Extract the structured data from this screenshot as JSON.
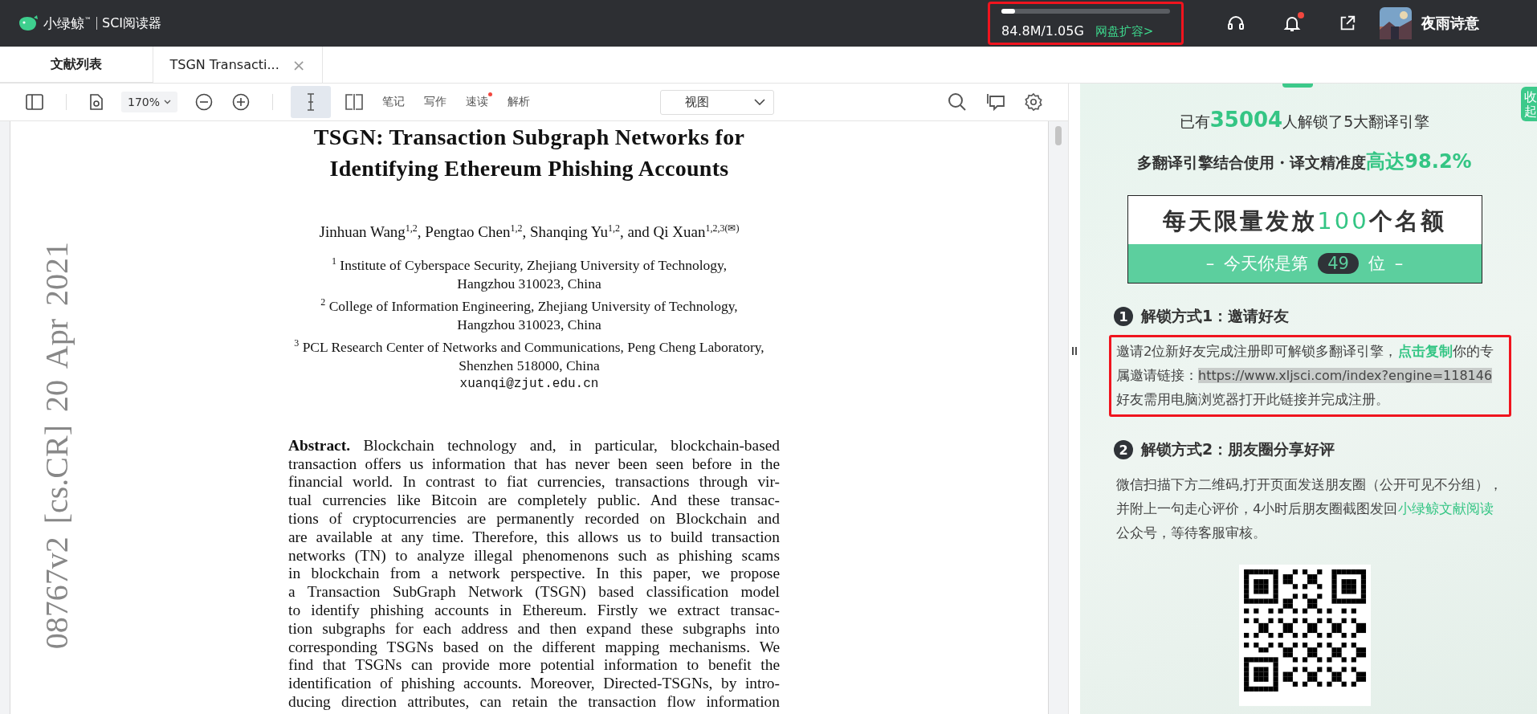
{
  "app_bar": {
    "logo_text": "小绿鲸",
    "trademark": "™",
    "product": "SCI阅读器",
    "storage": {
      "level": 0.08,
      "usage": "84.8M/1.05G",
      "upgrade_link": "网盘扩容>",
      "annotated": true
    },
    "notification_badge": true,
    "user_name": "夜雨诗意"
  },
  "tabs": [
    {
      "label": "文献列表",
      "kind": "home",
      "selected": false
    },
    {
      "label": "TSGN Transacti...",
      "kind": "document",
      "selected": true,
      "close": "×"
    }
  ],
  "toolbar": {
    "zoom": "170%",
    "text_select_active": true,
    "tools": [
      {
        "label": "笔记",
        "badge": false
      },
      {
        "label": "写作",
        "badge": false
      },
      {
        "label": "速读",
        "badge": true
      },
      {
        "label": "解析",
        "badge": false
      }
    ],
    "view": "视图"
  },
  "pdf": {
    "side_stamp": "08767v2 [cs.CR] 20 Apr 2021",
    "title_lines": [
      "TSGN: Transaction Subgraph Networks for",
      "Identifying Ethereum Phishing Accounts"
    ],
    "authors": "Jinhuan Wang$^{1,2}$, Pengtao Chen$^{1,2}$, Shanqing Yu$^{1,2}$, and Qi Xuan$^{1,2,3(✉)}$",
    "affiliations": [
      "$^{1}$ Institute of Cyberspace Security, Zhejiang University of Technology,",
      "Hangzhou 310023, China",
      "$^{2}$ College of Information Engineering, Zhejiang University of Technology,",
      "Hangzhou 310023, China",
      "$^{3}$ PCL Research Center of Networks and Communications, Peng Cheng Laboratory,",
      "Shenzhen 518000, China"
    ],
    "email": "xuanqi@zjut.edu.cn",
    "abstract_lines": [
      "**Abstract.** Blockchain technology and, in particular, blockchain-based",
      "transaction offers us information that has never been seen before in the",
      "financial world. In contrast to fiat currencies, transactions through vir-",
      "tual currencies like Bitcoin are completely public. And these transac-",
      "tions of cryptocurrencies are permanently recorded on Blockchain and",
      "are available at any time. Therefore, this allows us to build transaction",
      "networks (TN) to analyze illegal phenomenons such as phishing scams",
      "in blockchain from a network perspective. In this paper, we propose",
      "a Transaction SubGraph Network (TSGN) based classification model",
      "to identify phishing accounts in Ethereum. Firstly we extract transac-",
      "tion subgraphs for each address and then expand these subgraphs into",
      "corresponding TSGNs based on the different mapping mechanisms. We",
      "find that TSGNs can provide more potential information to benefit the",
      "identification of phishing accounts. Moreover, Directed-TSGNs, by intro-",
      "ducing direction attributes, can retain the transaction flow information"
    ]
  },
  "promo": {
    "collapse_tab": "收起",
    "stats": [
      {
        "before": "已有",
        "highlight": "35004",
        "after": "人解锁了5大翻译引擎",
        "kind": "count"
      },
      {
        "before": "多翻译引擎结合使用・译文精准度",
        "highlight": "高达98.2%",
        "kind": "accuracy"
      }
    ],
    "quota": {
      "before": "每天限量发放",
      "number": "100",
      "after": "个名额",
      "rank_dash_left": "–",
      "rank_before": "今天你是第",
      "rank": "49",
      "rank_after": "位",
      "rank_dash_right": "–"
    },
    "methods": [
      {
        "number": "1",
        "title": "解锁方式1：邀请好友",
        "kind": "invite",
        "annotated": true,
        "text_before": "邀请2位新好友完成注册即可解锁多翻译引擎，",
        "link": "点击复制",
        "text_middle": "你的专属邀请链接：",
        "url": "https://www.xljsci.com/index?engine=118146",
        "text_after": "好友需用电脑浏览器打开此链接并完成注册。"
      },
      {
        "number": "2",
        "title": "解锁方式2：朋友圈分享好评",
        "kind": "share",
        "annotated": false,
        "text_before": "微信扫描下方二维码,打开页面发送朋友圈（公开可见不分组），并附上一句走心评价，4小时后朋友圈截图发回",
        "link": "小绿鲸文献阅读",
        "text_after": "公众号，等待客服审核。"
      }
    ]
  }
}
